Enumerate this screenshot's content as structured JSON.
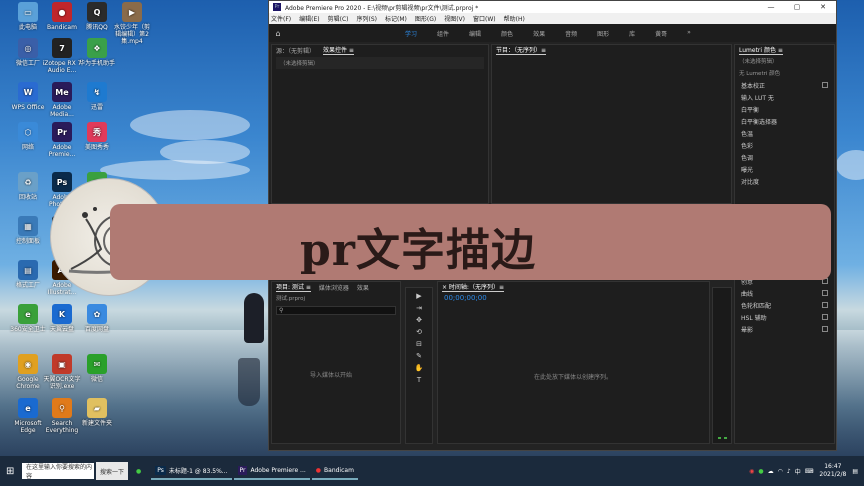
{
  "desktop_icons": [
    {
      "label": "此电脑",
      "name": "this-pc",
      "color": "#5aa0d8",
      "glyph": "▭"
    },
    {
      "label": "Bandicam",
      "name": "bandicam",
      "color": "#c0262b",
      "glyph": "●"
    },
    {
      "label": "腾讯QQ",
      "name": "qq",
      "color": "#2b2b2b",
      "glyph": "Q"
    },
    {
      "label": "水饺少年（剪辑编辑）第2集.mp4",
      "name": "video-file",
      "color": "#8a6b4a",
      "glyph": "▶"
    },
    {
      "label": "微信工厂",
      "name": "wechat-factory",
      "color": "#3a5fa8",
      "glyph": "◎"
    },
    {
      "label": "iZotope RX 7 Audio E...",
      "name": "izotope",
      "color": "#222",
      "glyph": "7"
    },
    {
      "label": "华为手机助手",
      "name": "huawei-assistant",
      "color": "#3aa04a",
      "glyph": "❖"
    },
    {
      "label": "WPS Office",
      "name": "wps",
      "color": "#2a6bd1",
      "glyph": "W"
    },
    {
      "label": "Adobe Media...",
      "name": "adobe-media-encoder",
      "color": "#2a1b5a",
      "glyph": "Me"
    },
    {
      "label": "迅雷",
      "name": "xunlei",
      "color": "#1e7ad0",
      "glyph": "↯"
    },
    {
      "label": "网络",
      "name": "network",
      "color": "#3a8ad8",
      "glyph": "⬡"
    },
    {
      "label": "Adobe Premie...",
      "name": "adobe-premiere",
      "color": "#2a1b5a",
      "glyph": "Pr"
    },
    {
      "label": "美图秀秀",
      "name": "meitu",
      "color": "#e03a5a",
      "glyph": "秀"
    },
    {
      "label": "回收站",
      "name": "recycle-bin",
      "color": "#6aa0c8",
      "glyph": "♻"
    },
    {
      "label": "Adobe Photos...",
      "name": "adobe-photoshop",
      "color": "#0a2a4a",
      "glyph": "Ps"
    },
    {
      "label": "",
      "name": "green-app",
      "color": "#3aa040",
      "glyph": "◐"
    },
    {
      "label": "控制面板",
      "name": "control-panel",
      "color": "#3a7ab8",
      "glyph": "▦"
    },
    {
      "label": "",
      "name": "lr-app",
      "color": "#1a2a3a",
      "glyph": "L"
    },
    {
      "label": "格式工厂",
      "name": "format-factory",
      "color": "#2a6ab0",
      "glyph": "▤"
    },
    {
      "label": "Adobe Illustrat...",
      "name": "adobe-illustrator",
      "color": "#3a1a00",
      "glyph": "Ai"
    },
    {
      "label": "360安全卫士",
      "name": "360-safe",
      "color": "#3aa03a",
      "glyph": "e"
    },
    {
      "label": "天翼云盘",
      "name": "tianyi-cloud",
      "color": "#1a6ad0",
      "glyph": "K"
    },
    {
      "label": "百度网盘",
      "name": "baidu-pan",
      "color": "#3a8ae0",
      "glyph": "✿"
    },
    {
      "label": "Google Chrome",
      "name": "chrome",
      "color": "#e0a020",
      "glyph": "◉"
    },
    {
      "label": "天翼OCR文字识别.exe",
      "name": "ocr-app",
      "color": "#c03a2a",
      "glyph": "▣"
    },
    {
      "label": "微信",
      "name": "wechat",
      "color": "#2aa02a",
      "glyph": "✉"
    },
    {
      "label": "Microsoft Edge",
      "name": "edge",
      "color": "#1a6ad0",
      "glyph": "e"
    },
    {
      "label": "Search Everything",
      "name": "everything",
      "color": "#e07a1a",
      "glyph": "⚲"
    },
    {
      "label": "新建文件夹",
      "name": "new-folder",
      "color": "#e0c060",
      "glyph": "▰"
    }
  ],
  "app": {
    "title": "Adobe Premiere Pro 2020 - E:\\视频\\pr剪辑视频\\pr文件\\测试.prproj *",
    "logo": "Pr",
    "window_controls": [
      "—",
      "▢",
      "✕"
    ],
    "menu": [
      "文件(F)",
      "编辑(E)",
      "剪辑(C)",
      "序列(S)",
      "标记(M)",
      "图形(G)",
      "视图(V)",
      "窗口(W)",
      "帮助(H)"
    ],
    "workspaces": [
      "学习",
      "组件",
      "编辑",
      "颜色",
      "效果",
      "音频",
      "图形",
      "库",
      "黄哥"
    ],
    "more": "»",
    "source_panel": {
      "tabs": [
        "源：（无剪辑）",
        "效果控件 ≡"
      ],
      "sub": "（未选择剪辑）"
    },
    "program_panel": {
      "tab": "节目：（无序列）≡"
    },
    "lumetri": {
      "tab": "Lumetri 颜色 ≡",
      "sub1": "（未选择剪辑）",
      "sub2": "无  Lumetri 颜色",
      "sections": [
        {
          "label": "基本校正"
        },
        {
          "label": "输入 LUT  无"
        },
        {
          "label": "白平衡"
        },
        {
          "label": "白平衡选择器"
        },
        {
          "label": "色温"
        },
        {
          "label": "色彩"
        },
        {
          "label": "色调"
        },
        {
          "label": "曝光"
        },
        {
          "label": "对比度"
        }
      ],
      "lower": [
        "创意",
        "曲线",
        "色轮和匹配",
        "HSL 辅助",
        "晕影"
      ]
    },
    "project_panel": {
      "tabs": [
        "项目: 测试 ≡",
        "媒体浏览器",
        "效果"
      ],
      "file": "测试.prproj",
      "hint": "导入媒体以开始"
    },
    "timeline_panel": {
      "tab": "× 时间轴:（无序列）≡",
      "timecode": "00;00;00;00",
      "hint": "在此处放下媒体以创建序列。"
    },
    "tools": [
      "▶",
      "⇥",
      "✥",
      "⟲",
      "⊟",
      "✎",
      "✋",
      "T"
    ]
  },
  "banner": {
    "title": "pr文字描边"
  },
  "taskbar": {
    "search": "在这里输入你要搜索的内容",
    "search_btn": "搜索一下",
    "tasks": [
      {
        "label": "未标题-1 @ 83.5%...",
        "name": "task-photoshop"
      },
      {
        "label": "Adobe Premiere ...",
        "name": "task-premiere"
      },
      {
        "label": "Bandicam",
        "name": "task-bandicam"
      }
    ],
    "ime": "中",
    "time": "16:47",
    "date": "2021/2/8"
  }
}
